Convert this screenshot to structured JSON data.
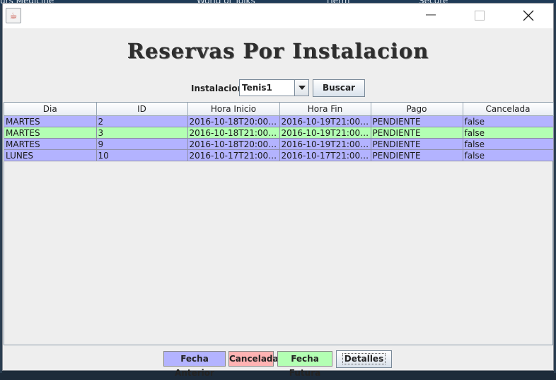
{
  "desktop": {
    "fragments": [
      "urs Medicine",
      "World of Toiks",
      "iTerm",
      "Secure"
    ]
  },
  "window": {
    "icon": "java-cup-icon"
  },
  "heading": "Reservas Por Instalacion",
  "filter": {
    "label": "Instalacion",
    "selected": "Tenis1",
    "search_button": "Buscar"
  },
  "table": {
    "columns": [
      "Dia",
      "ID",
      "Hora Inicio",
      "Hora Fin",
      "Pago",
      "Cancelada"
    ],
    "rows": [
      {
        "status": "past",
        "cells": [
          "MARTES",
          "2",
          "2016-10-18T20:00:0...",
          "2016-10-19T21:00:0...",
          "PENDIENTE",
          "false"
        ]
      },
      {
        "status": "future",
        "cells": [
          "MARTES",
          "3",
          "2016-10-18T21:00:0...",
          "2016-10-19T21:00:0...",
          "PENDIENTE",
          "false"
        ]
      },
      {
        "status": "past",
        "cells": [
          "MARTES",
          "9",
          "2016-10-18T20:00:0...",
          "2016-10-19T21:00:0...",
          "PENDIENTE",
          "false"
        ]
      },
      {
        "status": "past",
        "cells": [
          "LUNES",
          "10",
          "2016-10-17T21:00:0...",
          "2016-10-17T21:00:0...",
          "PENDIENTE",
          "false"
        ]
      }
    ]
  },
  "legend": {
    "past": "Fecha Anterior",
    "cancelled": "Cancelada",
    "future": "Fecha Futura",
    "details_button": "Detalles"
  },
  "colors": {
    "past": "#b3b3ff",
    "cancelled": "#ffb3b3",
    "future": "#b3ffb3"
  }
}
